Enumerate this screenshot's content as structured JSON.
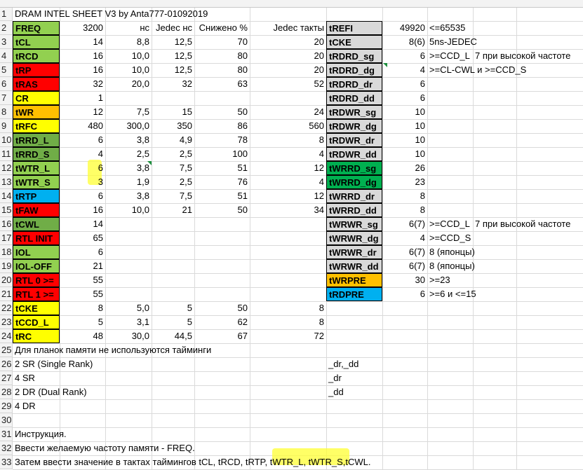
{
  "colors": {
    "green_light": "#92d050",
    "green_mid": "#70ad47",
    "green_dark": "#00b050",
    "red": "#ff0000",
    "yellow": "#ffff00",
    "orange": "#ffc000",
    "blue": "#00b0f0",
    "gray": "#d9d9d9"
  },
  "rows": [
    "1",
    "2",
    "3",
    "4",
    "5",
    "6",
    "7",
    "8",
    "9",
    "10",
    "11",
    "12",
    "13",
    "14",
    "15",
    "16",
    "17",
    "18",
    "19",
    "20",
    "21",
    "22",
    "23",
    "24",
    "25",
    "26",
    "27",
    "28",
    "29",
    "30",
    "31",
    "32",
    "33"
  ],
  "cells": [
    {
      "id": "A1",
      "r": 1,
      "col": "B",
      "v": "DRAM INTEL SHEET V3 by Anta777-01092019"
    },
    {
      "id": "B2",
      "r": 2,
      "col": "B",
      "v": "FREQ",
      "lbl": "green_light"
    },
    {
      "id": "C2",
      "r": 2,
      "col": "C",
      "v": "3200",
      "num": true
    },
    {
      "id": "D2",
      "r": 2,
      "col": "D",
      "v": "нс",
      "num": true
    },
    {
      "id": "E2",
      "r": 2,
      "col": "E",
      "v": "Jedec нс",
      "num": true
    },
    {
      "id": "F2",
      "r": 2,
      "col": "F",
      "v": "Снижено %",
      "num": true
    },
    {
      "id": "G2",
      "r": 2,
      "col": "G",
      "v": "Jedec такты",
      "num": true
    },
    {
      "id": "B3",
      "r": 3,
      "col": "B",
      "v": "tCL",
      "lbl": "green_light"
    },
    {
      "id": "C3",
      "r": 3,
      "col": "C",
      "v": "14",
      "num": true
    },
    {
      "id": "D3",
      "r": 3,
      "col": "D",
      "v": "8,8",
      "num": true
    },
    {
      "id": "E3",
      "r": 3,
      "col": "E",
      "v": "12,5",
      "num": true
    },
    {
      "id": "F3",
      "r": 3,
      "col": "F",
      "v": "70",
      "num": true
    },
    {
      "id": "G3",
      "r": 3,
      "col": "G",
      "v": "20",
      "num": true
    },
    {
      "id": "B4",
      "r": 4,
      "col": "B",
      "v": "tRCD",
      "lbl": "green_light"
    },
    {
      "id": "C4",
      "r": 4,
      "col": "C",
      "v": "16",
      "num": true
    },
    {
      "id": "D4",
      "r": 4,
      "col": "D",
      "v": "10,0",
      "num": true
    },
    {
      "id": "E4",
      "r": 4,
      "col": "E",
      "v": "12,5",
      "num": true
    },
    {
      "id": "F4",
      "r": 4,
      "col": "F",
      "v": "80",
      "num": true
    },
    {
      "id": "G4",
      "r": 4,
      "col": "G",
      "v": "20",
      "num": true
    },
    {
      "id": "B5",
      "r": 5,
      "col": "B",
      "v": "tRP",
      "lbl": "red"
    },
    {
      "id": "C5",
      "r": 5,
      "col": "C",
      "v": "16",
      "num": true
    },
    {
      "id": "D5",
      "r": 5,
      "col": "D",
      "v": "10,0",
      "num": true
    },
    {
      "id": "E5",
      "r": 5,
      "col": "E",
      "v": "12,5",
      "num": true
    },
    {
      "id": "F5",
      "r": 5,
      "col": "F",
      "v": "80",
      "num": true
    },
    {
      "id": "G5",
      "r": 5,
      "col": "G",
      "v": "20",
      "num": true
    },
    {
      "id": "B6",
      "r": 6,
      "col": "B",
      "v": "tRAS",
      "lbl": "red"
    },
    {
      "id": "C6",
      "r": 6,
      "col": "C",
      "v": "32",
      "num": true
    },
    {
      "id": "D6",
      "r": 6,
      "col": "D",
      "v": "20,0",
      "num": true
    },
    {
      "id": "E6",
      "r": 6,
      "col": "E",
      "v": "32",
      "num": true
    },
    {
      "id": "F6",
      "r": 6,
      "col": "F",
      "v": "63",
      "num": true
    },
    {
      "id": "G6",
      "r": 6,
      "col": "G",
      "v": "52",
      "num": true
    },
    {
      "id": "B7",
      "r": 7,
      "col": "B",
      "v": "CR",
      "lbl": "yellow"
    },
    {
      "id": "C7",
      "r": 7,
      "col": "C",
      "v": "1",
      "num": true
    },
    {
      "id": "B8",
      "r": 8,
      "col": "B",
      "v": "tWR",
      "lbl": "orange"
    },
    {
      "id": "C8",
      "r": 8,
      "col": "C",
      "v": "12",
      "num": true
    },
    {
      "id": "D8",
      "r": 8,
      "col": "D",
      "v": "7,5",
      "num": true
    },
    {
      "id": "E8",
      "r": 8,
      "col": "E",
      "v": "15",
      "num": true
    },
    {
      "id": "F8",
      "r": 8,
      "col": "F",
      "v": "50",
      "num": true
    },
    {
      "id": "G8",
      "r": 8,
      "col": "G",
      "v": "24",
      "num": true
    },
    {
      "id": "B9",
      "r": 9,
      "col": "B",
      "v": "tRFC",
      "lbl": "yellow"
    },
    {
      "id": "C9",
      "r": 9,
      "col": "C",
      "v": "480",
      "num": true
    },
    {
      "id": "D9",
      "r": 9,
      "col": "D",
      "v": "300,0",
      "num": true
    },
    {
      "id": "E9",
      "r": 9,
      "col": "E",
      "v": "350",
      "num": true
    },
    {
      "id": "F9",
      "r": 9,
      "col": "F",
      "v": "86",
      "num": true
    },
    {
      "id": "G9",
      "r": 9,
      "col": "G",
      "v": "560",
      "num": true
    },
    {
      "id": "B10",
      "r": 10,
      "col": "B",
      "v": "tRRD_L",
      "lbl": "green_mid"
    },
    {
      "id": "C10",
      "r": 10,
      "col": "C",
      "v": "6",
      "num": true
    },
    {
      "id": "D10",
      "r": 10,
      "col": "D",
      "v": "3,8",
      "num": true
    },
    {
      "id": "E10",
      "r": 10,
      "col": "E",
      "v": "4,9",
      "num": true
    },
    {
      "id": "F10",
      "r": 10,
      "col": "F",
      "v": "78",
      "num": true
    },
    {
      "id": "G10",
      "r": 10,
      "col": "G",
      "v": "8",
      "num": true
    },
    {
      "id": "B11",
      "r": 11,
      "col": "B",
      "v": "tRRD_S",
      "lbl": "green_mid"
    },
    {
      "id": "C11",
      "r": 11,
      "col": "C",
      "v": "4",
      "num": true
    },
    {
      "id": "D11",
      "r": 11,
      "col": "D",
      "v": "2,5",
      "num": true
    },
    {
      "id": "E11",
      "r": 11,
      "col": "E",
      "v": "2,5",
      "num": true
    },
    {
      "id": "F11",
      "r": 11,
      "col": "F",
      "v": "100",
      "num": true
    },
    {
      "id": "G11",
      "r": 11,
      "col": "G",
      "v": "4",
      "num": true
    },
    {
      "id": "B12",
      "r": 12,
      "col": "B",
      "v": "tWTR_L",
      "lbl": "green_light"
    },
    {
      "id": "C12",
      "r": 12,
      "col": "C",
      "v": "6",
      "num": true
    },
    {
      "id": "D12",
      "r": 12,
      "col": "D",
      "v": "3,8",
      "num": true
    },
    {
      "id": "E12",
      "r": 12,
      "col": "E",
      "v": "7,5",
      "num": true
    },
    {
      "id": "F12",
      "r": 12,
      "col": "F",
      "v": "51",
      "num": true
    },
    {
      "id": "G12",
      "r": 12,
      "col": "G",
      "v": "12",
      "num": true
    },
    {
      "id": "B13",
      "r": 13,
      "col": "B",
      "v": "tWTR_S",
      "lbl": "green_light"
    },
    {
      "id": "C13",
      "r": 13,
      "col": "C",
      "v": "3",
      "num": true
    },
    {
      "id": "D13",
      "r": 13,
      "col": "D",
      "v": "1,9",
      "num": true
    },
    {
      "id": "E13",
      "r": 13,
      "col": "E",
      "v": "2,5",
      "num": true
    },
    {
      "id": "F13",
      "r": 13,
      "col": "F",
      "v": "76",
      "num": true
    },
    {
      "id": "G13",
      "r": 13,
      "col": "G",
      "v": "4",
      "num": true
    },
    {
      "id": "B14",
      "r": 14,
      "col": "B",
      "v": "tRTP",
      "lbl": "blue"
    },
    {
      "id": "C14",
      "r": 14,
      "col": "C",
      "v": "6",
      "num": true
    },
    {
      "id": "D14",
      "r": 14,
      "col": "D",
      "v": "3,8",
      "num": true
    },
    {
      "id": "E14",
      "r": 14,
      "col": "E",
      "v": "7,5",
      "num": true
    },
    {
      "id": "F14",
      "r": 14,
      "col": "F",
      "v": "51",
      "num": true
    },
    {
      "id": "G14",
      "r": 14,
      "col": "G",
      "v": "12",
      "num": true
    },
    {
      "id": "B15",
      "r": 15,
      "col": "B",
      "v": "tFAW",
      "lbl": "red"
    },
    {
      "id": "C15",
      "r": 15,
      "col": "C",
      "v": "16",
      "num": true
    },
    {
      "id": "D15",
      "r": 15,
      "col": "D",
      "v": "10,0",
      "num": true
    },
    {
      "id": "E15",
      "r": 15,
      "col": "E",
      "v": "21",
      "num": true
    },
    {
      "id": "F15",
      "r": 15,
      "col": "F",
      "v": "50",
      "num": true
    },
    {
      "id": "G15",
      "r": 15,
      "col": "G",
      "v": "34",
      "num": true
    },
    {
      "id": "B16",
      "r": 16,
      "col": "B",
      "v": "tCWL",
      "lbl": "green_mid"
    },
    {
      "id": "C16",
      "r": 16,
      "col": "C",
      "v": "14",
      "num": true
    },
    {
      "id": "B17",
      "r": 17,
      "col": "B",
      "v": "RTL INIT",
      "lbl": "red"
    },
    {
      "id": "C17",
      "r": 17,
      "col": "C",
      "v": "65",
      "num": true
    },
    {
      "id": "B18",
      "r": 18,
      "col": "B",
      "v": "IOL",
      "lbl": "green_light"
    },
    {
      "id": "C18",
      "r": 18,
      "col": "C",
      "v": "6",
      "num": true
    },
    {
      "id": "B19",
      "r": 19,
      "col": "B",
      "v": "IOL-OFF",
      "lbl": "green_light"
    },
    {
      "id": "C19",
      "r": 19,
      "col": "C",
      "v": "21",
      "num": true
    },
    {
      "id": "B20",
      "r": 20,
      "col": "B",
      "v": "RTL 0 >=",
      "lbl": "red"
    },
    {
      "id": "C20",
      "r": 20,
      "col": "C",
      "v": "55",
      "num": true
    },
    {
      "id": "B21",
      "r": 21,
      "col": "B",
      "v": "RTL 1 >=",
      "lbl": "red"
    },
    {
      "id": "C21",
      "r": 21,
      "col": "C",
      "v": "55",
      "num": true
    },
    {
      "id": "B22",
      "r": 22,
      "col": "B",
      "v": "tCKE",
      "lbl": "yellow"
    },
    {
      "id": "C22",
      "r": 22,
      "col": "C",
      "v": "8",
      "num": true
    },
    {
      "id": "D22",
      "r": 22,
      "col": "D",
      "v": "5,0",
      "num": true
    },
    {
      "id": "E22",
      "r": 22,
      "col": "E",
      "v": "5",
      "num": true
    },
    {
      "id": "F22",
      "r": 22,
      "col": "F",
      "v": "50",
      "num": true
    },
    {
      "id": "G22",
      "r": 22,
      "col": "G",
      "v": "8",
      "num": true
    },
    {
      "id": "B23",
      "r": 23,
      "col": "B",
      "v": "tCCD_L",
      "lbl": "yellow"
    },
    {
      "id": "C23",
      "r": 23,
      "col": "C",
      "v": "5",
      "num": true
    },
    {
      "id": "D23",
      "r": 23,
      "col": "D",
      "v": "3,1",
      "num": true
    },
    {
      "id": "E23",
      "r": 23,
      "col": "E",
      "v": "5",
      "num": true
    },
    {
      "id": "F23",
      "r": 23,
      "col": "F",
      "v": "62",
      "num": true
    },
    {
      "id": "G23",
      "r": 23,
      "col": "G",
      "v": "8",
      "num": true
    },
    {
      "id": "B24",
      "r": 24,
      "col": "B",
      "v": "tRC",
      "lbl": "yellow"
    },
    {
      "id": "C24",
      "r": 24,
      "col": "C",
      "v": "48",
      "num": true
    },
    {
      "id": "D24",
      "r": 24,
      "col": "D",
      "v": "30,0",
      "num": true
    },
    {
      "id": "E24",
      "r": 24,
      "col": "E",
      "v": "44,5",
      "num": true
    },
    {
      "id": "F24",
      "r": 24,
      "col": "F",
      "v": "67",
      "num": true
    },
    {
      "id": "G24",
      "r": 24,
      "col": "G",
      "v": "72",
      "num": true
    },
    {
      "id": "A25",
      "r": 25,
      "col": "B",
      "v": "Для планок памяти не используются тайминги"
    },
    {
      "id": "A26",
      "r": 26,
      "col": "B",
      "v": "2 SR (Single Rank)"
    },
    {
      "id": "A27",
      "r": 27,
      "col": "B",
      "v": "4 SR"
    },
    {
      "id": "A28",
      "r": 28,
      "col": "B",
      "v": "2 DR (Dual Rank)"
    },
    {
      "id": "A29",
      "r": 29,
      "col": "B",
      "v": "4 DR"
    },
    {
      "id": "A31",
      "r": 31,
      "col": "B",
      "v": "Инструкция."
    },
    {
      "id": "A32",
      "r": 32,
      "col": "B",
      "v": "Ввести желаемую частоту памяти - FREQ."
    },
    {
      "id": "A33",
      "r": 33,
      "col": "B",
      "v": "Затем ввести значение в тактах таймингов tCL, tRCD, tRTP, tWTR_L, tWTR_S,tCWL."
    },
    {
      "id": "H26",
      "r": 26,
      "col": "H",
      "v": "_dr,_dd"
    },
    {
      "id": "H27",
      "r": 27,
      "col": "H",
      "v": "_dr"
    },
    {
      "id": "H28",
      "r": 28,
      "col": "H",
      "v": "_dd"
    },
    {
      "id": "H2",
      "r": 2,
      "col": "H",
      "v": "tREFI",
      "lbl": "gray"
    },
    {
      "id": "I2",
      "r": 2,
      "col": "I",
      "v": "49920",
      "num": true
    },
    {
      "id": "J2",
      "r": 2,
      "col": "J",
      "v": "<=65535"
    },
    {
      "id": "H3",
      "r": 3,
      "col": "H",
      "v": "tCKE",
      "lbl": "gray"
    },
    {
      "id": "I3",
      "r": 3,
      "col": "I",
      "v": "8(6)",
      "num": true
    },
    {
      "id": "J3",
      "r": 3,
      "col": "J",
      "v": "5ns-JEDEC"
    },
    {
      "id": "H4",
      "r": 4,
      "col": "H",
      "v": "tRDRD_sg",
      "lbl": "gray"
    },
    {
      "id": "I4",
      "r": 4,
      "col": "I",
      "v": "6",
      "num": true
    },
    {
      "id": "J4",
      "r": 4,
      "col": "J",
      "v": ">=CCD_L"
    },
    {
      "id": "K4",
      "r": 4,
      "col": "K",
      "v": "7 при высокой частоте"
    },
    {
      "id": "H5",
      "r": 5,
      "col": "H",
      "v": "tRDRD_dg",
      "lbl": "gray"
    },
    {
      "id": "I5",
      "r": 5,
      "col": "I",
      "v": "4",
      "num": true
    },
    {
      "id": "J5",
      "r": 5,
      "col": "J",
      "v": ">=CL-CWL и >=CCD_S"
    },
    {
      "id": "H6",
      "r": 6,
      "col": "H",
      "v": "tRDRD_dr",
      "lbl": "gray"
    },
    {
      "id": "I6",
      "r": 6,
      "col": "I",
      "v": "6",
      "num": true
    },
    {
      "id": "H7",
      "r": 7,
      "col": "H",
      "v": "tRDRD_dd",
      "lbl": "gray"
    },
    {
      "id": "I7",
      "r": 7,
      "col": "I",
      "v": "6",
      "num": true
    },
    {
      "id": "H8",
      "r": 8,
      "col": "H",
      "v": "tRDWR_sg",
      "lbl": "gray"
    },
    {
      "id": "I8",
      "r": 8,
      "col": "I",
      "v": "10",
      "num": true
    },
    {
      "id": "H9",
      "r": 9,
      "col": "H",
      "v": "tRDWR_dg",
      "lbl": "gray"
    },
    {
      "id": "I9",
      "r": 9,
      "col": "I",
      "v": "10",
      "num": true
    },
    {
      "id": "H10",
      "r": 10,
      "col": "H",
      "v": "tRDWR_dr",
      "lbl": "gray"
    },
    {
      "id": "I10",
      "r": 10,
      "col": "I",
      "v": "10",
      "num": true
    },
    {
      "id": "H11",
      "r": 11,
      "col": "H",
      "v": "tRDWR_dd",
      "lbl": "gray"
    },
    {
      "id": "I11",
      "r": 11,
      "col": "I",
      "v": "10",
      "num": true
    },
    {
      "id": "H12",
      "r": 12,
      "col": "H",
      "v": "tWRRD_sg",
      "lbl": "green_dark"
    },
    {
      "id": "I12",
      "r": 12,
      "col": "I",
      "v": "26",
      "num": true
    },
    {
      "id": "H13",
      "r": 13,
      "col": "H",
      "v": "tWRRD_dg",
      "lbl": "green_dark"
    },
    {
      "id": "I13",
      "r": 13,
      "col": "I",
      "v": "23",
      "num": true
    },
    {
      "id": "H14",
      "r": 14,
      "col": "H",
      "v": "tWRRD_dr",
      "lbl": "gray"
    },
    {
      "id": "I14",
      "r": 14,
      "col": "I",
      "v": "8",
      "num": true
    },
    {
      "id": "H15",
      "r": 15,
      "col": "H",
      "v": "tWRRD_dd",
      "lbl": "gray"
    },
    {
      "id": "I15",
      "r": 15,
      "col": "I",
      "v": "8",
      "num": true
    },
    {
      "id": "H16",
      "r": 16,
      "col": "H",
      "v": "tWRWR_sg",
      "lbl": "gray"
    },
    {
      "id": "I16",
      "r": 16,
      "col": "I",
      "v": "6(7)",
      "num": true
    },
    {
      "id": "J16",
      "r": 16,
      "col": "J",
      "v": ">=CCD_L"
    },
    {
      "id": "K16",
      "r": 16,
      "col": "K",
      "v": "7 при высокой частоте"
    },
    {
      "id": "H17",
      "r": 17,
      "col": "H",
      "v": "tWRWR_dg",
      "lbl": "gray"
    },
    {
      "id": "I17",
      "r": 17,
      "col": "I",
      "v": "4",
      "num": true
    },
    {
      "id": "J17",
      "r": 17,
      "col": "J",
      "v": ">=CCD_S"
    },
    {
      "id": "H18",
      "r": 18,
      "col": "H",
      "v": "tWRWR_dr",
      "lbl": "gray"
    },
    {
      "id": "I18",
      "r": 18,
      "col": "I",
      "v": "6(7)",
      "num": true
    },
    {
      "id": "J18",
      "r": 18,
      "col": "JK",
      "v": "8 (японцы)"
    },
    {
      "id": "H19",
      "r": 19,
      "col": "H",
      "v": "tWRWR_dd",
      "lbl": "gray"
    },
    {
      "id": "I19",
      "r": 19,
      "col": "I",
      "v": "6(7)",
      "num": true
    },
    {
      "id": "J19",
      "r": 19,
      "col": "JK",
      "v": "8 (японцы)"
    },
    {
      "id": "H20",
      "r": 20,
      "col": "H",
      "v": "tWRPRE",
      "lbl": "orange"
    },
    {
      "id": "I20",
      "r": 20,
      "col": "I",
      "v": "30",
      "num": true
    },
    {
      "id": "J20",
      "r": 20,
      "col": "J",
      "v": ">=23"
    },
    {
      "id": "H21",
      "r": 21,
      "col": "H",
      "v": "tRDPRE",
      "lbl": "blue"
    },
    {
      "id": "I21",
      "r": 21,
      "col": "I",
      "v": "6",
      "num": true
    },
    {
      "id": "J21",
      "r": 21,
      "col": "J",
      "v": ">=6 и <=15"
    }
  ]
}
